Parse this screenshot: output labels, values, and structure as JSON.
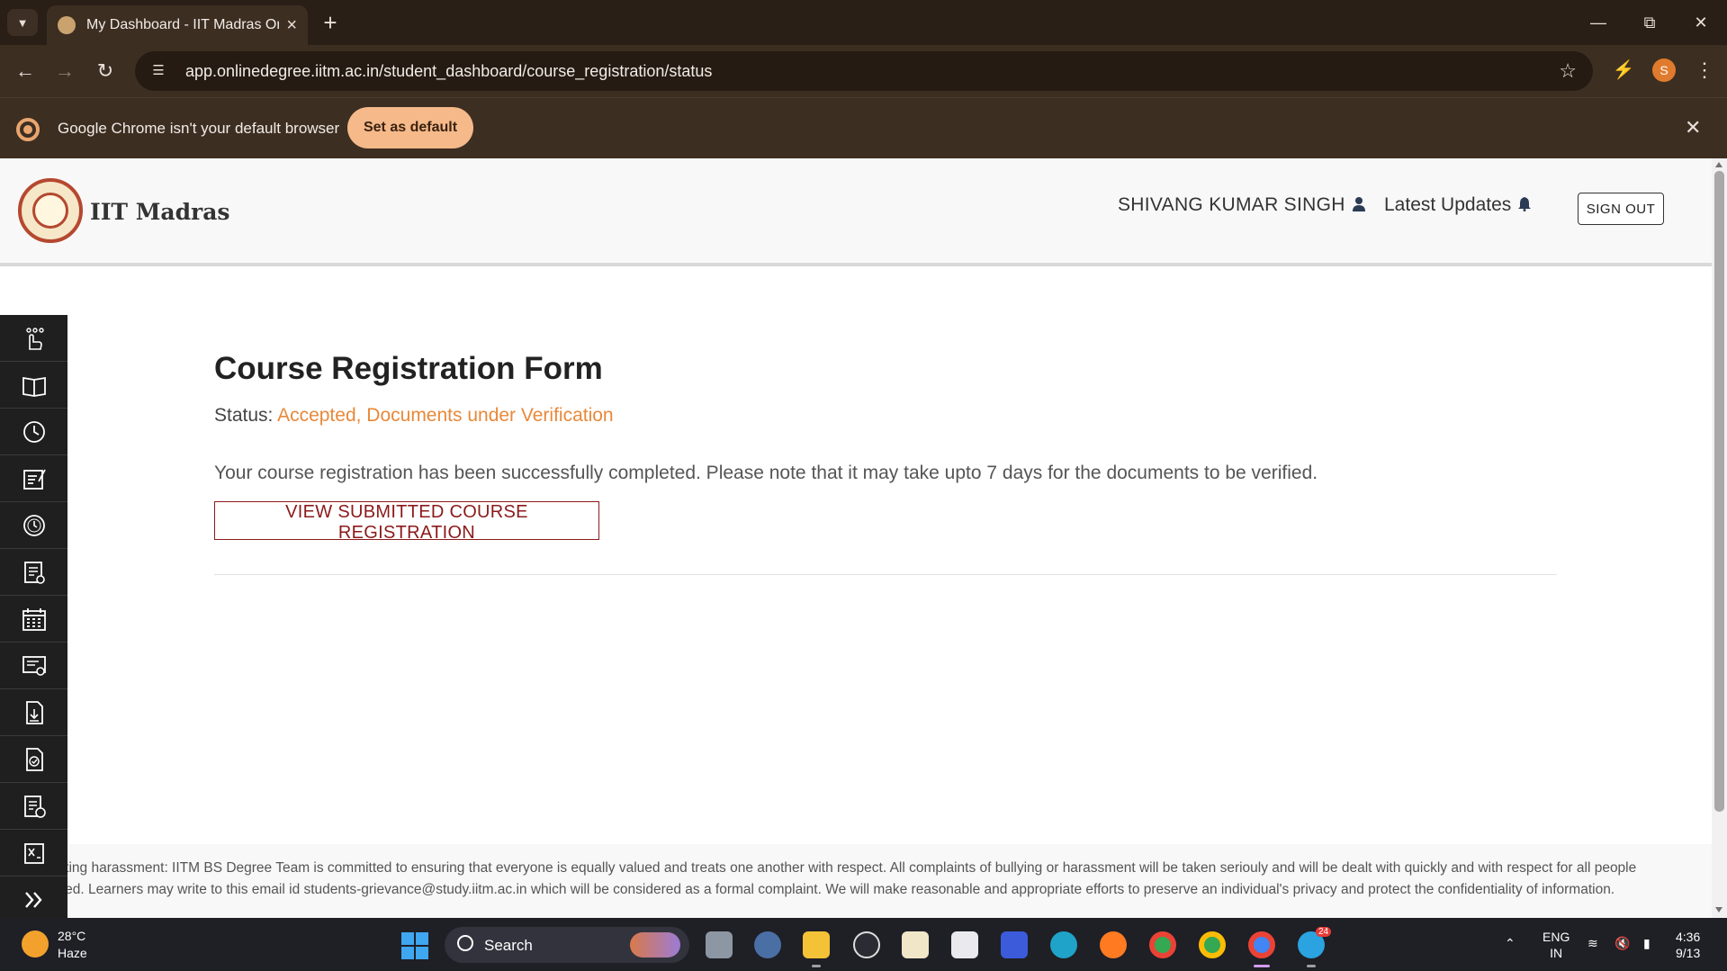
{
  "browser": {
    "tab_title": "My Dashboard - IIT Madras Onl",
    "url": "app.onlinedegree.iitm.ac.in/student_dashboard/course_registration/status",
    "infobar_message": "Google Chrome isn't your default browser",
    "set_default_label": "Set as default",
    "profile_initial": "S"
  },
  "header": {
    "brand": "IIT Madras",
    "user_name": "SHIVANG KUMAR SINGH",
    "updates_label": "Latest Updates",
    "signout_label": "SIGN OUT"
  },
  "sidebar": {
    "items": [
      "hand-pointer-icon",
      "book-icon",
      "history-icon",
      "edit-doc-icon",
      "clock-icon",
      "checklist-icon",
      "calendar-icon",
      "certificate-icon",
      "download-doc-icon",
      "approved-doc-icon",
      "fee-doc-icon",
      "grade-sheet-icon",
      "expand-icon"
    ]
  },
  "main": {
    "title": "Course Registration Form",
    "status_label": "Status:",
    "status_value": "Accepted, Documents under Verification",
    "message": "Your course registration has been successfully completed. Please note that it may take upto 7 days for the documents to be verified.",
    "view_button": "VIEW SUBMITTED COURSE REGISTRATION"
  },
  "footer": {
    "line1": "rting harassment: IITM BS Degree Team is committed to ensuring that everyone is equally valued and treats one another with respect. All complaints of bullying or harassment will be taken seriouly and will be dealt with quickly and with respect for all people",
    "line2": "red. Learners may write to this email id students-grievance@study.iitm.ac.in which will be considered as a formal complaint. We will make reasonable and appropriate efforts to preserve an individual's privacy and protect the confidentiality of information."
  },
  "taskbar": {
    "temperature": "28°C",
    "weather": "Haze",
    "search_label": "Search",
    "lang_line1": "ENG",
    "lang_line2": "IN",
    "time": "4:36",
    "date": "9/13",
    "telegram_badge": "24"
  },
  "colors": {
    "status_accent": "#e8893a",
    "button_accent": "#8b1a1a",
    "chrome_bg": "#3d2e22"
  }
}
